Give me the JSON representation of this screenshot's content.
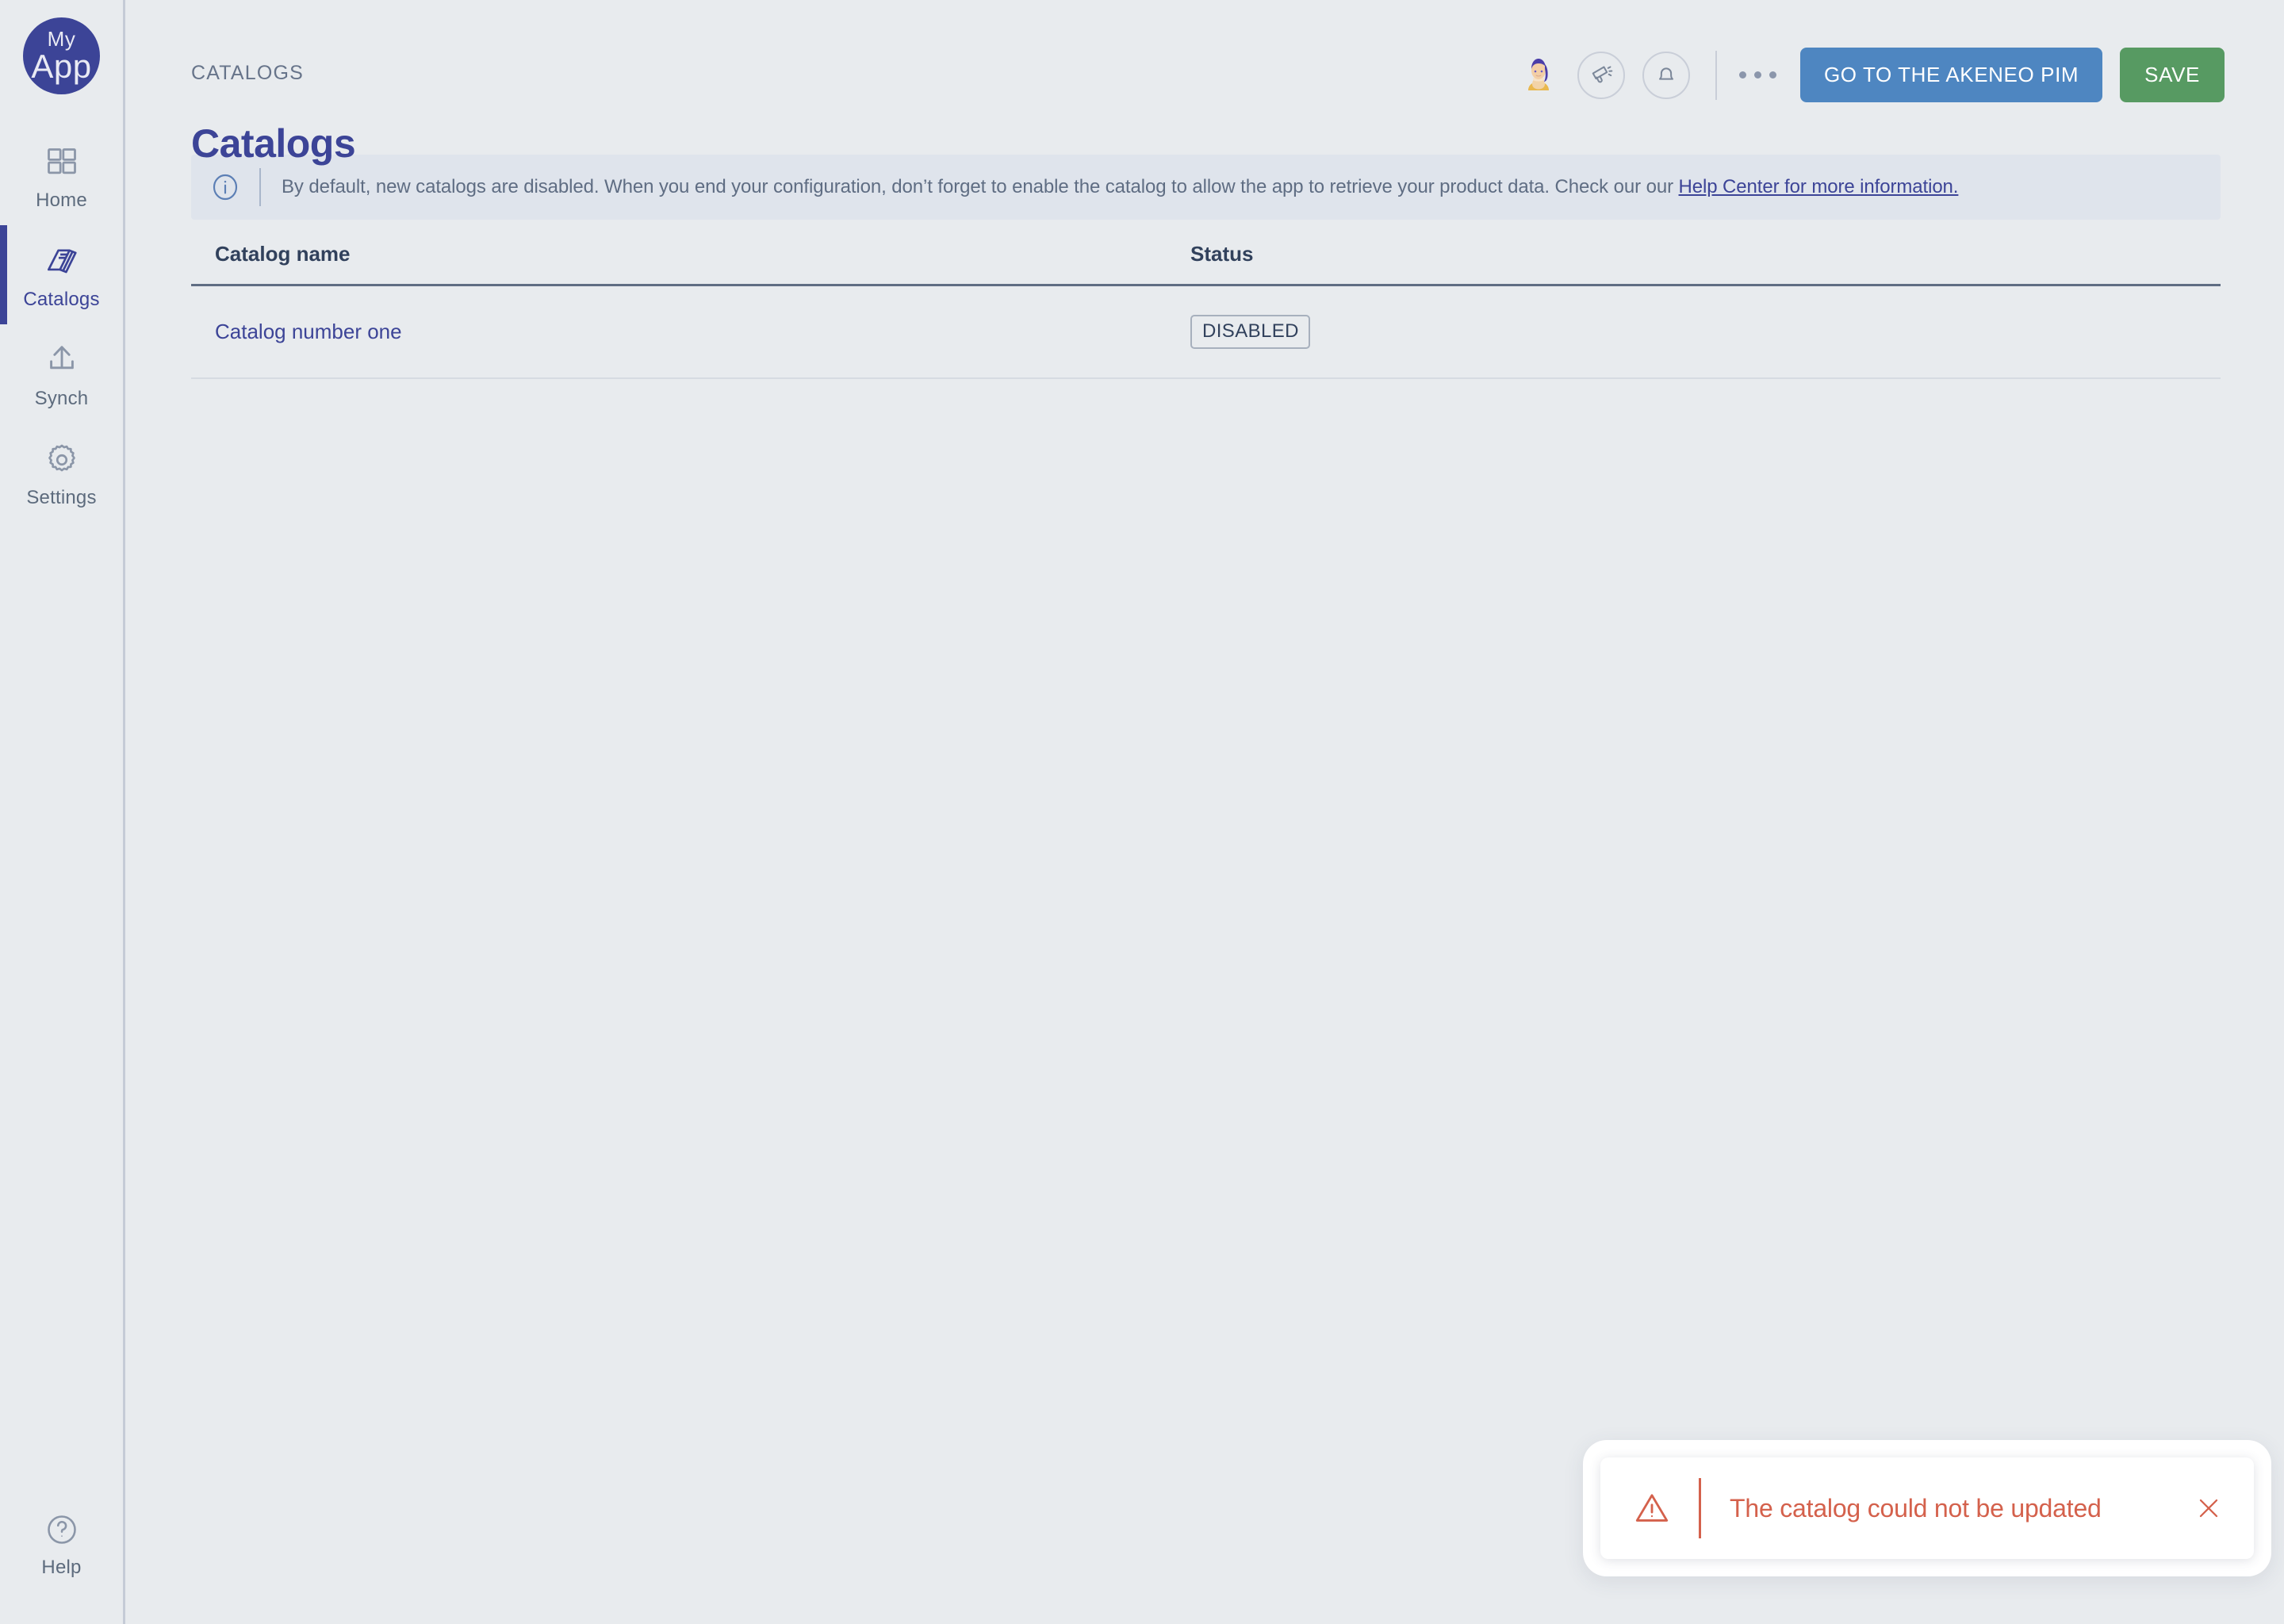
{
  "app": {
    "logo_line1": "My",
    "logo_line2": "App",
    "brand_color": "#3c4497"
  },
  "sidebar": {
    "items": [
      {
        "label": "Home",
        "icon": "grid-icon",
        "active": false
      },
      {
        "label": "Catalogs",
        "icon": "books-icon",
        "active": true
      },
      {
        "label": "Synch",
        "icon": "upload-icon",
        "active": false
      },
      {
        "label": "Settings",
        "icon": "gear-icon",
        "active": false
      }
    ],
    "bottom": {
      "label": "Help",
      "icon": "question-circle-icon"
    }
  },
  "header": {
    "breadcrumb": "CATALOGS",
    "title": "Catalogs",
    "avatar_icon": "user-avatar",
    "announcement_icon": "megaphone-icon",
    "notifications_icon": "bell-icon",
    "more_icon": "ellipsis-icon",
    "akeneo_button": "GO TO THE AKENEO PIM",
    "save_button": "SAVE",
    "akeneo_color": "#4e86c1",
    "save_color": "#579a62"
  },
  "banner": {
    "icon": "info-circle-icon",
    "text": "By default, new catalogs are disabled. When you end your configuration, don’t forget to enable the catalog to allow the app to retrieve your product data. Check our our ",
    "link_text": "Help Center for more information."
  },
  "table": {
    "columns": [
      "Catalog name",
      "Status"
    ],
    "rows": [
      {
        "name": "Catalog number one",
        "status": "DISABLED"
      }
    ]
  },
  "toast": {
    "icon": "warning-triangle-icon",
    "message": "The catalog could not be updated",
    "close_icon": "close-icon",
    "color": "#d4614c"
  }
}
